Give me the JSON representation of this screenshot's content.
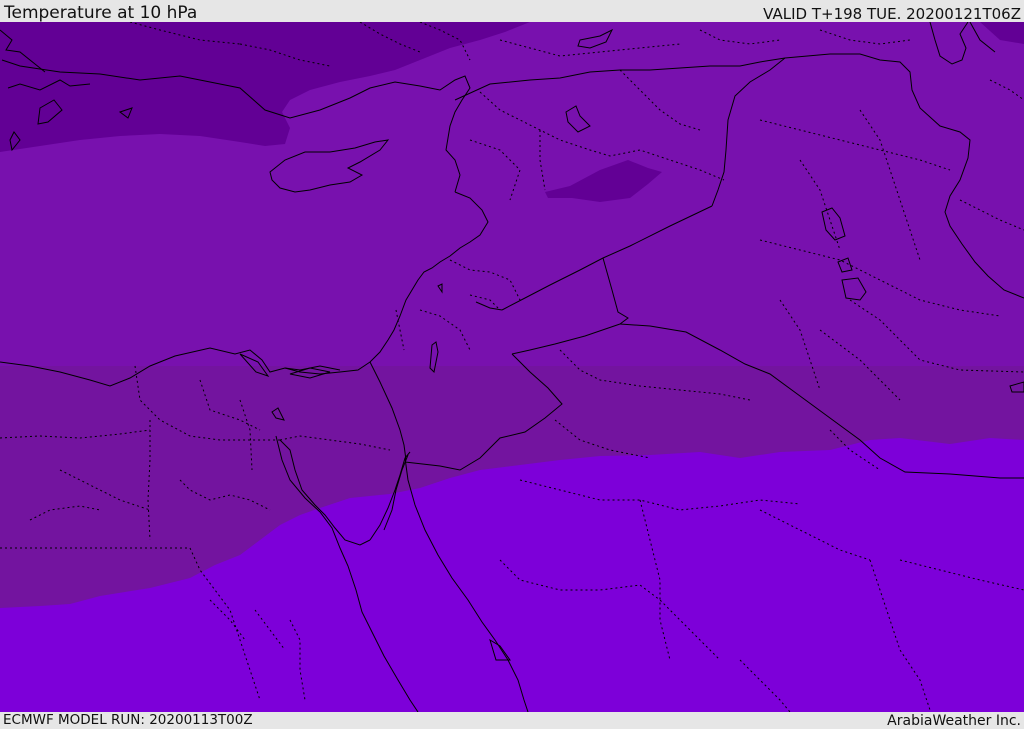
{
  "header": {
    "title": "Temperature at 10 hPa",
    "valid": "VALID T+198 TUE. 20200121T06Z"
  },
  "footer": {
    "model_run": "ECMWF MODEL RUN: 20200113T00Z",
    "credit": "ArabiaWeather Inc."
  },
  "map": {
    "temperature_band_colors": {
      "coldest_band": "#620095",
      "cold_band": "#7811ae",
      "mid_band": "#73149f",
      "warm_band": "#7d00d9"
    },
    "coastline_color": "#000000",
    "border_style": "dotted-and-solid-black-lines"
  }
}
